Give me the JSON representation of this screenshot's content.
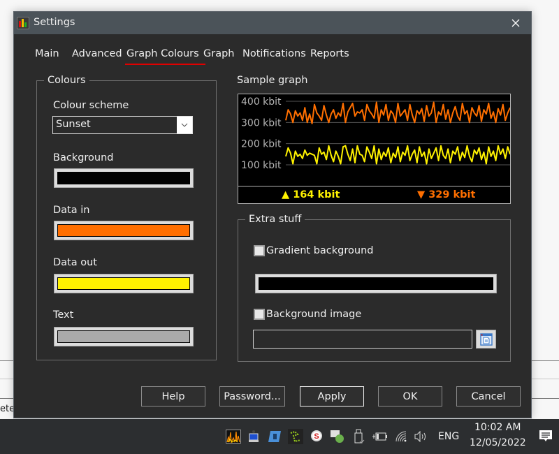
{
  "window": {
    "title": "Settings",
    "close_label": "×"
  },
  "tabs": [
    {
      "label": "Main",
      "active": false
    },
    {
      "label": "Advanced",
      "active": false
    },
    {
      "label": "Graph Colours",
      "active": true
    },
    {
      "label": "Graph",
      "active": false
    },
    {
      "label": "Notifications",
      "active": false
    },
    {
      "label": "Reports",
      "active": false
    }
  ],
  "colours": {
    "legend": "Colours",
    "scheme_label": "Colour scheme",
    "scheme_value": "Sunset",
    "background_label": "Background",
    "background_color": "#000000",
    "data_in_label": "Data in",
    "data_in_color": "#ff6f00",
    "data_out_label": "Data out",
    "data_out_color": "#fff200",
    "text_label": "Text",
    "text_color": "#aaaaaa"
  },
  "sample_graph": {
    "label": "Sample graph",
    "y_ticks": [
      "400 kbit",
      "300 kbit",
      "200 kbit",
      "100 kbit"
    ],
    "upload_readout": "▲ 164 kbit",
    "download_readout": "▼ 329 kbit",
    "upload_color": "#fff200",
    "download_color": "#ff6f00"
  },
  "chart_data": {
    "type": "line",
    "title": "Sample graph",
    "xlabel": "",
    "ylabel": "",
    "y_tick_labels": [
      "100 kbit",
      "200 kbit",
      "300 kbit",
      "400 kbit"
    ],
    "ylim": [
      0,
      450
    ],
    "grid": true,
    "series": [
      {
        "name": "Data in",
        "color": "#ff6f00",
        "range": [
          290,
          400
        ],
        "values": [
          310,
          360,
          340,
          300,
          355,
          330,
          345,
          310,
          370,
          300,
          340,
          295,
          385,
          345,
          330,
          310,
          380,
          335,
          300,
          340,
          360,
          320,
          345,
          330,
          390,
          300,
          350,
          370,
          390,
          330,
          350,
          345,
          360,
          310,
          385,
          355,
          340,
          320,
          395,
          300,
          360,
          335,
          385,
          310,
          355,
          340,
          300,
          390,
          330,
          345,
          360,
          310,
          385,
          335,
          300,
          355,
          340,
          365,
          305,
          380,
          330,
          345,
          395,
          300,
          350,
          335,
          385,
          315,
          360,
          300,
          345,
          375,
          330,
          310,
          390,
          340,
          355,
          300,
          370,
          345,
          330,
          380,
          305,
          360,
          340,
          390,
          320,
          350,
          300,
          365,
          335,
          385,
          310,
          345,
          370
        ]
      },
      {
        "name": "Data out",
        "color": "#fff200",
        "range": [
          100,
          195
        ],
        "values": [
          140,
          180,
          155,
          105,
          165,
          140,
          150,
          130,
          170,
          145,
          155,
          150,
          145,
          105,
          180,
          150,
          160,
          125,
          190,
          145,
          115,
          165,
          140,
          105,
          185,
          190,
          150,
          120,
          175,
          110,
          190,
          150,
          145,
          115,
          185,
          160,
          130,
          190,
          105,
          175,
          125,
          160,
          140,
          180,
          110,
          155,
          135,
          185,
          115,
          160,
          145,
          190,
          120,
          150,
          170,
          110,
          185,
          140,
          160,
          105,
          175,
          130,
          155,
          180,
          120,
          190,
          145,
          130,
          175,
          110,
          165,
          150,
          185,
          120,
          160,
          135,
          190,
          140,
          115,
          170,
          150,
          180,
          125,
          160,
          105,
          185,
          140,
          165,
          120,
          190,
          150,
          175,
          130,
          185,
          150
        ]
      }
    ],
    "readouts": {
      "upload": "164 kbit",
      "download": "329 kbit"
    }
  },
  "extra": {
    "legend": "Extra stuff",
    "gradient_label": "Gradient background",
    "gradient_checked": false,
    "gradient_color": "#000000",
    "bg_image_label": "Background image",
    "bg_image_checked": false,
    "bg_image_path": ""
  },
  "buttons": {
    "help": "Help",
    "password": "Password...",
    "apply": "Apply",
    "ok": "OK",
    "cancel": "Cancel"
  },
  "background_app": {
    "partial_text": "ete"
  },
  "taskbar": {
    "language": "ENG",
    "time": "10:02 AM",
    "date": "12/05/2022"
  }
}
